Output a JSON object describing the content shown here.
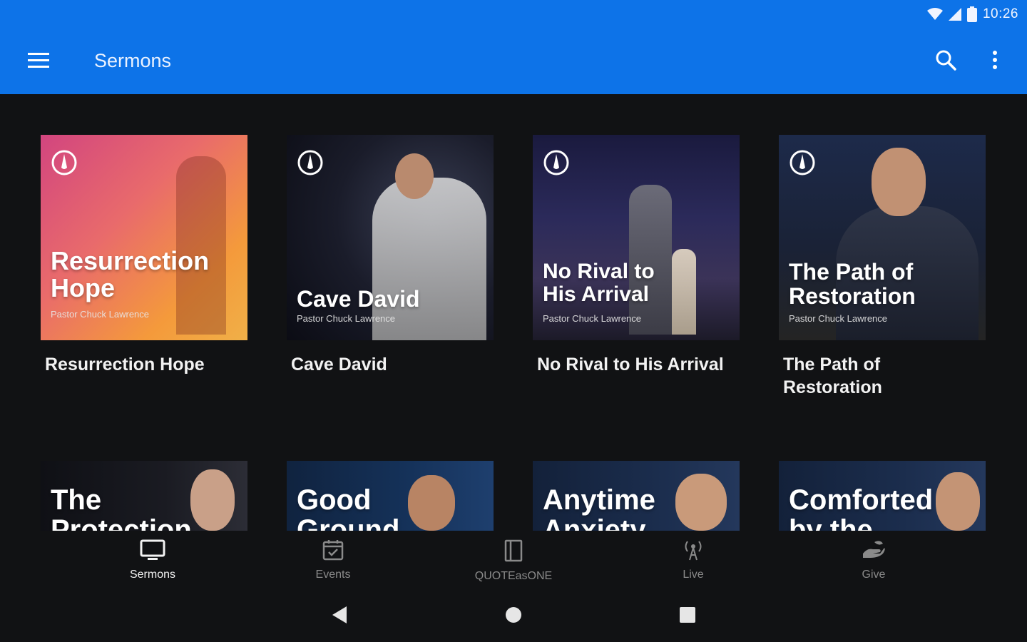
{
  "status_bar": {
    "time": "10:26",
    "icons": [
      "wifi-icon",
      "cell-signal-icon",
      "battery-icon"
    ]
  },
  "app_bar": {
    "title": "Sermons",
    "menu_icon": "hamburger-menu-icon",
    "search_icon": "search-icon",
    "more_icon": "more-vert-icon",
    "color": "#0d73e8"
  },
  "sermons": [
    {
      "thumb_title_lines": [
        "Resurrection",
        "Hope"
      ],
      "pastor": "Pastor Chuck Lawrence",
      "label": "Resurrection Hope"
    },
    {
      "thumb_title_lines": [
        "Cave David"
      ],
      "pastor": "Pastor Chuck Lawrence",
      "label": "Cave David"
    },
    {
      "thumb_title_lines": [
        "No Rival to",
        "His Arrival"
      ],
      "pastor": "Pastor Chuck Lawrence",
      "label": "No Rival to His Arrival"
    },
    {
      "thumb_title_lines": [
        "The Path of",
        "Restoration"
      ],
      "pastor": "Pastor Chuck Lawrence",
      "label": "The Path of Restoration"
    },
    {
      "thumb_title_lines": [
        "The",
        "Protection"
      ],
      "label": ""
    },
    {
      "thumb_title_lines": [
        "Good",
        "Ground"
      ],
      "label": ""
    },
    {
      "thumb_title_lines": [
        "Anytime",
        "Anxiety"
      ],
      "label": ""
    },
    {
      "thumb_title_lines": [
        "Comforted",
        "by the"
      ],
      "label": ""
    }
  ],
  "bottom_nav": [
    {
      "label": "Sermons",
      "icon": "tv-icon",
      "active": true
    },
    {
      "label": "Events",
      "icon": "calendar-icon",
      "active": false
    },
    {
      "label": "QUOTEasONE",
      "icon": "book-icon",
      "active": false
    },
    {
      "label": "Live",
      "icon": "broadcast-icon",
      "active": false
    },
    {
      "label": "Give",
      "icon": "hand-give-icon",
      "active": false
    }
  ],
  "system_nav": [
    "back-icon",
    "home-icon",
    "recents-icon"
  ]
}
